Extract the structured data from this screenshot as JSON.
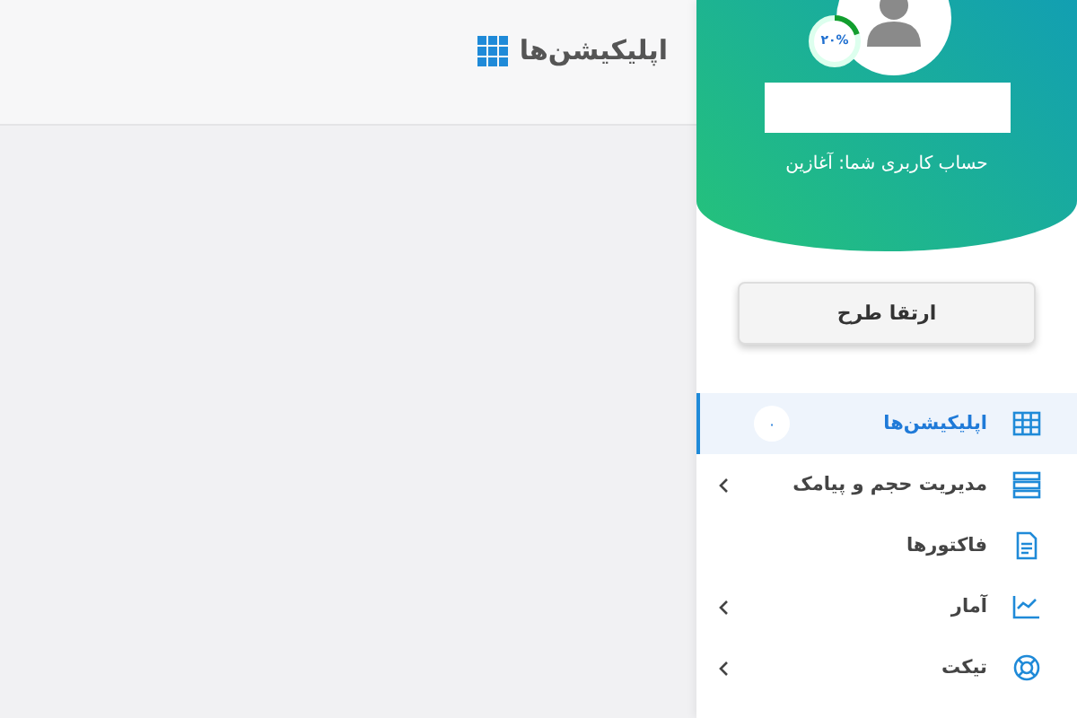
{
  "page_header": {
    "title": "اپلیکیشن‌ها"
  },
  "profile": {
    "progress": {
      "label": "۲۰%",
      "level": 0.2
    },
    "account_text": "حساب کاربری شما: آغازین"
  },
  "upgrade_button": "ارتقا طرح",
  "menu": [
    {
      "label": "اپلیکیشن‌ها",
      "kind": "grid",
      "selected": true,
      "badge": "۰",
      "expandable": false
    },
    {
      "label": "مدیریت حجم و پیامک",
      "kind": "storage",
      "selected": false,
      "expandable": true
    },
    {
      "label": "فاکتورها",
      "kind": "invoice",
      "selected": false,
      "expandable": false
    },
    {
      "label": "آمار",
      "kind": "chart",
      "selected": false,
      "expandable": true
    },
    {
      "label": "تیکت",
      "kind": "support",
      "selected": false,
      "expandable": true
    }
  ]
}
